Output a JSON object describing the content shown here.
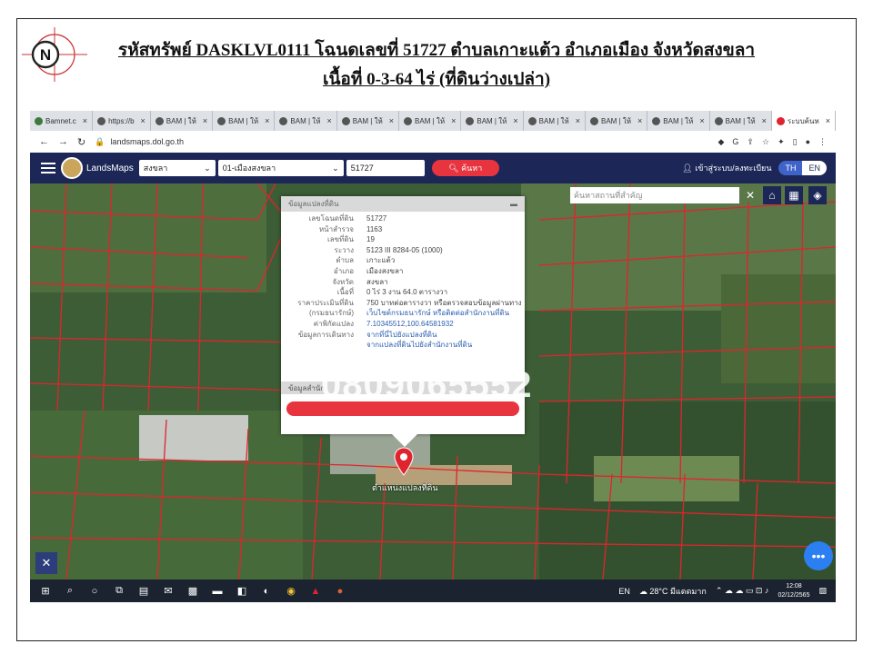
{
  "doc": {
    "title_line1": "รหัสทรัพย์ DASKLVL0111 โฉนดเลขที่ 51727 ตำบลเกาะแต้ว อำเภอเมือง จังหวัดสงขลา",
    "title_line2": "เนื้อที่ 0-3-64 ไร่ (ที่ดินว่างเปล่า)",
    "compass_letter": "N"
  },
  "browser": {
    "tabs": [
      {
        "label": "Bamnet.c"
      },
      {
        "label": "https://b"
      },
      {
        "label": "BAM | ให้"
      },
      {
        "label": "BAM | ให้"
      },
      {
        "label": "BAM | ให้"
      },
      {
        "label": "BAM | ให้"
      },
      {
        "label": "BAM | ให้"
      },
      {
        "label": "BAM | ให้"
      },
      {
        "label": "BAM | ให้"
      },
      {
        "label": "BAM | ให้"
      },
      {
        "label": "BAM | ให้"
      },
      {
        "label": "BAM | ให้"
      },
      {
        "label": "ระบบค้นห"
      }
    ],
    "new_tab": "+",
    "url": "landsmaps.dol.go.th"
  },
  "app": {
    "brand": "LandsMaps",
    "province": "สงขลา",
    "district": "01-เมืองสงขลา",
    "parcel_no": "51727",
    "search_label": "ค้นหา",
    "login_label": "เข้าสู่ระบบ/ลงทะเบียน",
    "lang_th": "TH",
    "lang_en": "EN",
    "map_search_placeholder": "ค้นหาสถานที่สำคัญ"
  },
  "panel": {
    "header": "ข้อมูลแปลงที่ดิน",
    "rows": [
      {
        "k": "เลขโฉนดที่ดิน",
        "v": "51727"
      },
      {
        "k": "หน้าสำรวจ",
        "v": "1163"
      },
      {
        "k": "เลขที่ดิน",
        "v": "19"
      },
      {
        "k": "ระวาง",
        "v": "5123 III 8284-05 (1000)"
      },
      {
        "k": "ตำบล",
        "v": "เกาะแต้ว"
      },
      {
        "k": "อำเภอ",
        "v": "เมืองสงขลา"
      },
      {
        "k": "จังหวัด",
        "v": "สงขลา"
      },
      {
        "k": "เนื้อที่",
        "v": "0 ไร่ 3 งาน 64.0 ตารางวา"
      },
      {
        "k": "ราคาประเมินที่ดิน",
        "v": "750 บาทต่อตารางวา หรือตรวจสอบข้อมูลผ่านทาง"
      },
      {
        "k": "(กรมธนารักษ์)",
        "v": "เว็บไซต์กรมธนารักษ์ หรือติดต่อสำนักงานที่ดิน"
      },
      {
        "k": "ค่าพิกัดแปลง",
        "v": "7.10345512,100.64581932"
      },
      {
        "k": "ข้อมูลการเดินทาง",
        "v": "จากที่นี่ไปยังแปลงที่ดิน"
      },
      {
        "k": "",
        "v": "จากแปลงที่ดินไปยังสำนักงานที่ดิน"
      }
    ],
    "header2": "ข้อมูลสำนัก",
    "watermark": "0809065552"
  },
  "map": {
    "pin_label": "ตำแหน่งแปลงที่ดิน"
  },
  "taskbar": {
    "lang": "EN",
    "weather": "28°C มีแดดมาก",
    "time": "12:08",
    "date": "02/12/2565"
  }
}
